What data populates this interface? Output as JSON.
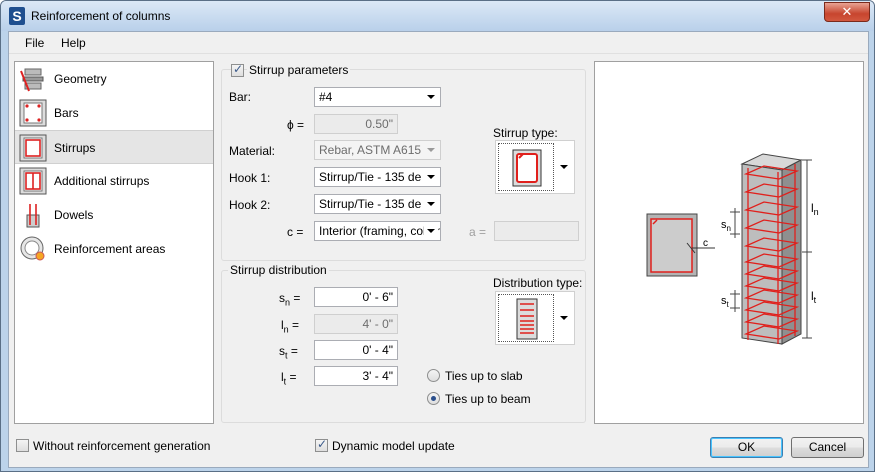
{
  "window": {
    "title": "Reinforcement of columns",
    "app_icon_letter": "S",
    "close_symbol": "✕"
  },
  "menu": {
    "file": "File",
    "help": "Help"
  },
  "sidebar": {
    "items": [
      {
        "label": "Geometry",
        "icon": "geometry-icon"
      },
      {
        "label": "Bars",
        "icon": "bars-icon"
      },
      {
        "label": "Stirrups",
        "icon": "stirrups-icon"
      },
      {
        "label": "Additional stirrups",
        "icon": "additional-stirrups-icon"
      },
      {
        "label": "Dowels",
        "icon": "dowels-icon"
      },
      {
        "label": "Reinforcement areas",
        "icon": "reinforcement-areas-icon"
      }
    ],
    "selected": "Stirrups"
  },
  "stirrup_params": {
    "title": "Stirrup parameters",
    "checked": true,
    "bar_label": "Bar:",
    "bar_value": "#4",
    "phi_label": "ϕ =",
    "phi_value": "0.50\"",
    "material_label": "Material:",
    "material_value": "Rebar,  ASTM A615",
    "hook1_label": "Hook 1:",
    "hook1_value": "Stirrup/Tie - 135 de",
    "hook2_label": "Hook 2:",
    "hook2_value": "Stirrup/Tie - 135 de",
    "c_label": "c =",
    "c_value": "Interior (framing, colum",
    "a_label": "a =",
    "a_value": "",
    "stirrup_type_label": "Stirrup type:"
  },
  "stirrup_distribution": {
    "title": "Stirrup distribution",
    "sn_label": "s",
    "sn_sub": "n",
    "sn_value": "0' - 6\"",
    "ln_label": "l",
    "ln_sub": "n",
    "ln_value": "4' - 0\"",
    "st_label": "s",
    "st_sub": "t",
    "st_value": "0' - 4\"",
    "lt_label": "l",
    "lt_sub": "t",
    "lt_value": "3' - 4\"",
    "eq": "=",
    "distribution_type_label": "Distribution type:",
    "ties_slab": "Ties up to slab",
    "ties_beam": "Ties up to beam",
    "selected_tie": "beam"
  },
  "preview": {
    "label_c": "c",
    "label_sn": "s",
    "label_sn_sub": "n",
    "label_st": "s",
    "label_st_sub": "t",
    "label_ln": "l",
    "label_ln_sub": "n",
    "label_lt": "l",
    "label_lt_sub": "t",
    "stirrup_color": "#e0201c"
  },
  "footer": {
    "without_generation": "Without reinforcement generation",
    "without_generation_checked": false,
    "dynamic_update": "Dynamic model update",
    "dynamic_update_checked": true,
    "ok": "OK",
    "cancel": "Cancel"
  }
}
